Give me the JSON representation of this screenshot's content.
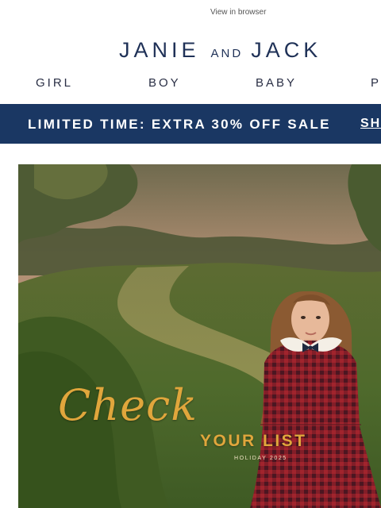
{
  "header": {
    "view_in_browser": "View in browser"
  },
  "logo": {
    "part1": "JANIE",
    "connector": "AND",
    "part2": "JACK"
  },
  "nav": {
    "items": [
      {
        "label": "GIRL"
      },
      {
        "label": "BOY"
      },
      {
        "label": "BABY"
      },
      {
        "label": "P"
      }
    ]
  },
  "promo_banner": {
    "text": "LIMITED TIME: EXTRA 30% OFF SALE",
    "link_label": "SH"
  },
  "hero": {
    "script_text": "Check",
    "title": "YOUR LIST",
    "subtitle": "HOLIDAY 2025"
  },
  "colors": {
    "brand_navy": "#1f3157",
    "banner_bg": "#1a3763",
    "hero_gold": "#e0a63c"
  }
}
